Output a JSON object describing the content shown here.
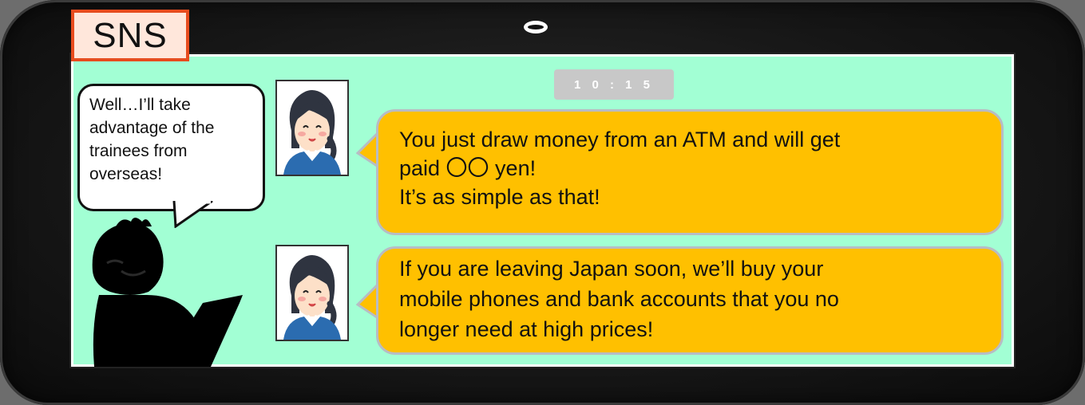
{
  "header": {
    "label": "SNS"
  },
  "chat": {
    "timestamp": "1 0 : 1 5",
    "messages": [
      {
        "lines": [
          "You just draw money from an ATM and will get",
          "paid 〇〇 yen!",
          "It’s as simple as that!"
        ]
      },
      {
        "lines": [
          "If you are leaving Japan soon, we’ll buy your",
          "mobile phones and bank accounts that you no",
          "longer need at high prices!"
        ]
      }
    ]
  },
  "scammer": {
    "thought": [
      "Well…I’ll take",
      "advantage of the",
      "trainees from",
      "overseas!"
    ]
  },
  "colors": {
    "screen_bg": "#a2ffd4",
    "bubble": "#ffc000",
    "label_border": "#e74c1e"
  }
}
